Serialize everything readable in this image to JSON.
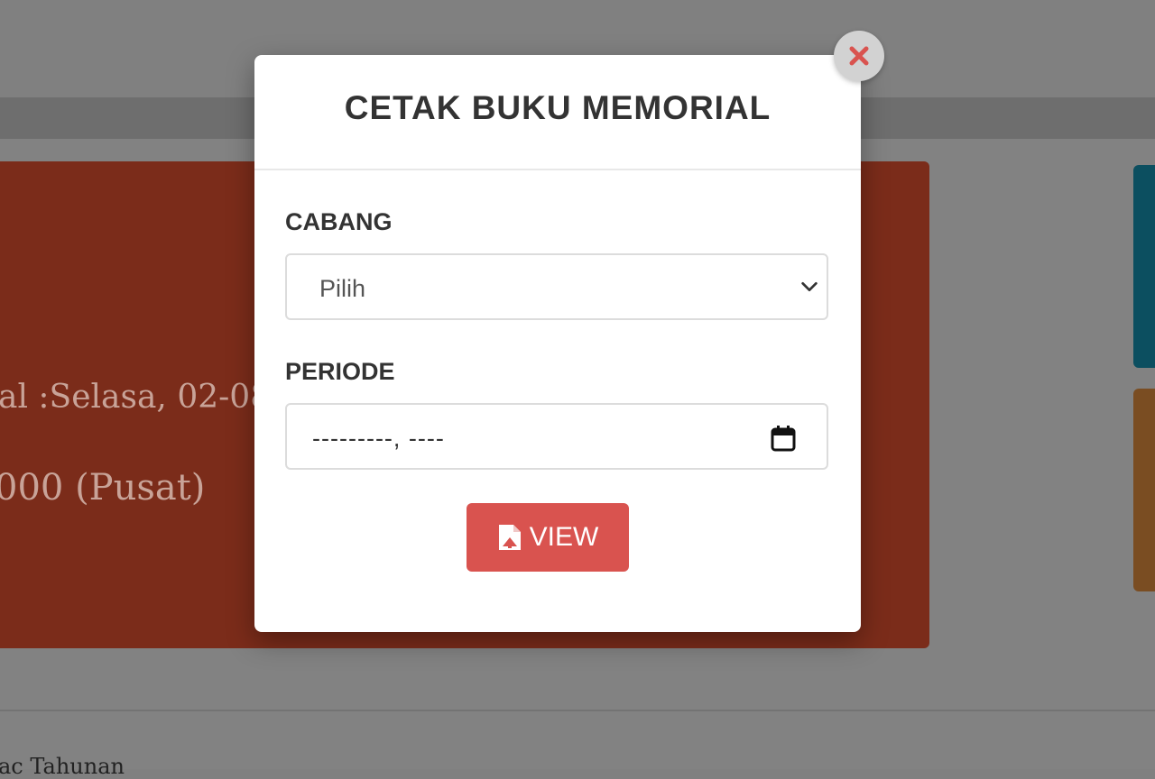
{
  "background": {
    "card_date_text": "al :Selasa, 02-08",
    "card_branch_text": "000 (Pusat)",
    "bottom_text": "ac Tahunan"
  },
  "modal": {
    "title": "CETAK BUKU MEMORIAL",
    "cabang_label": "CABANG",
    "cabang_selected": "Pilih",
    "periode_label": "PERIODE",
    "periode_placeholder": "---------, ----",
    "view_button": "VIEW"
  },
  "colors": {
    "accent_button": "#d9534f",
    "close_icon": "#d9534f",
    "card_bg": "#7b2c1a",
    "side_teal": "#0c4f60",
    "side_orange": "#7a4d22"
  },
  "icons": {
    "close": "close-icon",
    "select": "chevron-down-icon",
    "date": "calendar-icon",
    "view": "file-pdf-icon"
  }
}
